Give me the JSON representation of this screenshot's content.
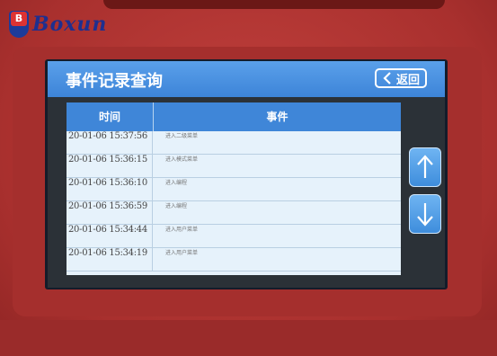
{
  "brand": {
    "name": "Boxun",
    "mark": "B"
  },
  "screen": {
    "title": "事件记录查询",
    "back_label": "返回",
    "table": {
      "columns": [
        "时间",
        "事件"
      ],
      "rows": [
        {
          "time": "20-01-06  15:37:56",
          "event": "进入二级菜单"
        },
        {
          "time": "20-01-06  15:36:15",
          "event": "进入模式菜单"
        },
        {
          "time": "20-01-06  15:36:10",
          "event": "进入编程"
        },
        {
          "time": "20-01-06  15:36:59",
          "event": "进入编程"
        },
        {
          "time": "20-01-06  15:34:44",
          "event": "进入用户菜单"
        },
        {
          "time": "20-01-06  15:34:19",
          "event": "进入用户菜单"
        }
      ]
    },
    "scroll": {
      "up_icon": "arrow-up-icon",
      "down_icon": "arrow-down-icon"
    }
  },
  "colors": {
    "housing": "#b63a37",
    "title_bar": "#4a90e2",
    "table_header": "#3f86d8",
    "table_body": "#e6f2fb"
  }
}
